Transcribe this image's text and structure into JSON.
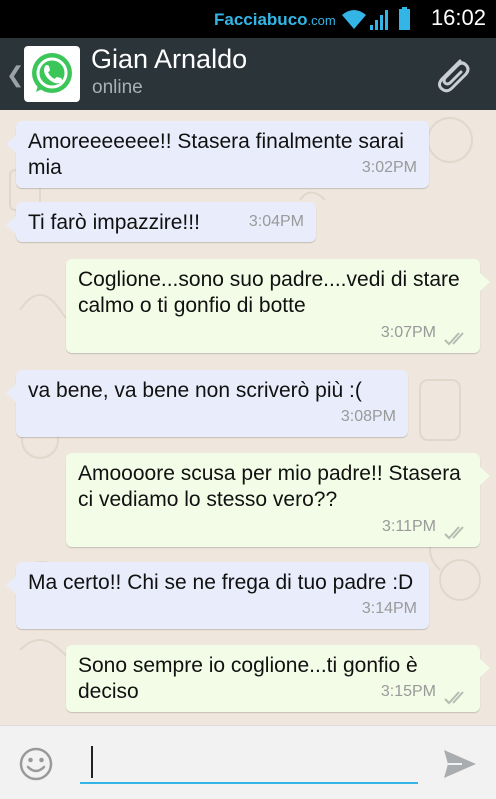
{
  "status_bar": {
    "watermark_name": "Facciabuco",
    "watermark_domain": ".com",
    "time": "16:02"
  },
  "header": {
    "contact_name": "Gian Arnaldo",
    "contact_status": "online",
    "avatar_icon": "whatsapp-logo-icon",
    "attach_icon": "paperclip-icon"
  },
  "messages": [
    {
      "direction": "in",
      "text": "Amoreeeeeee!! Stasera finalmente sarai mia",
      "time": "3:02PM"
    },
    {
      "direction": "in",
      "text": "Ti farò impazzire!!!",
      "time": "3:04PM"
    },
    {
      "direction": "out",
      "text": "Coglione...sono suo padre....vedi di stare calmo o ti gonfio di botte",
      "time": "3:07PM"
    },
    {
      "direction": "in",
      "text": "va bene, va bene non scriverò più :(",
      "time": "3:08PM"
    },
    {
      "direction": "out",
      "text": "Amoooore scusa per mio padre!! Stasera ci vediamo lo stesso vero??",
      "time": "3:11PM"
    },
    {
      "direction": "in",
      "text": "Ma certo!! Chi se ne frega di tuo padre :D",
      "time": "3:14PM"
    },
    {
      "direction": "out",
      "text": "Sono sempre io coglione...ti gonfio è deciso",
      "time": "3:15PM"
    }
  ],
  "input": {
    "value": "",
    "emoji_icon": "smiley-icon",
    "send_icon": "send-arrow-icon"
  },
  "colors": {
    "action_bar": "#2b3439",
    "incoming_bubble": "#e9ecfb",
    "outgoing_bubble": "#f3fce6",
    "accent": "#33b5e5"
  }
}
